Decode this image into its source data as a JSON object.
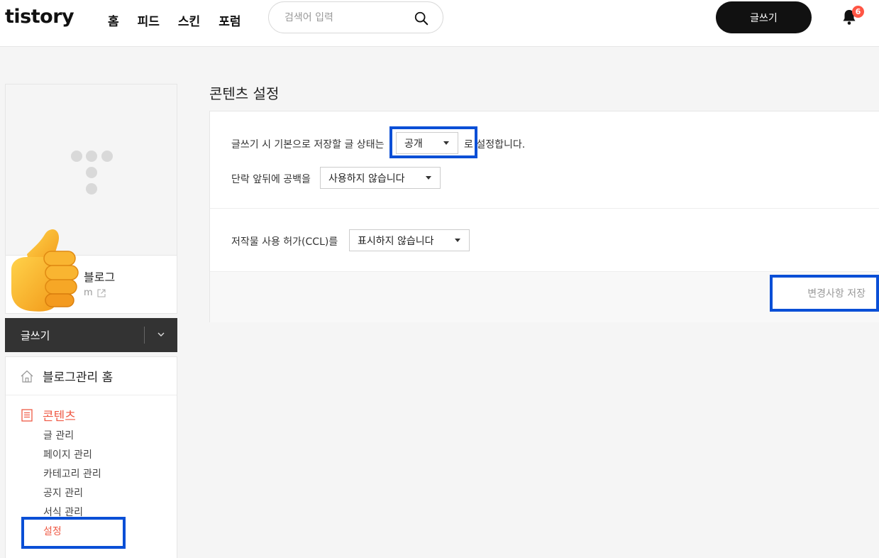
{
  "header": {
    "logo": "tistory",
    "nav": [
      "홈",
      "피드",
      "스킨",
      "포럼"
    ],
    "search_placeholder": "검색어 입력",
    "write_label": "글쓰기",
    "notification_count": "6"
  },
  "sidebar": {
    "blog_name": "블로그",
    "blog_url_fragment": "m",
    "write_label": "글쓰기",
    "home_label": "블로그관리 홈",
    "content_label": "콘텐츠",
    "submenu": [
      "글 관리",
      "페이지 관리",
      "카테고리 관리",
      "공지 관리",
      "서식 관리",
      "설정"
    ]
  },
  "main": {
    "title": "콘텐츠 설정",
    "row1_prefix": "글쓰기 시 기본으로 저장할 글 상태는",
    "row1_value": "공개",
    "row1_suffix": "로 설정합니다.",
    "row2_prefix": "단락 앞뒤에 공백을",
    "row2_value": "사용하지 않습니다",
    "row3_prefix": "저작물 사용 허가(CCL)를",
    "row3_value": "표시하지 않습니다",
    "save_label": "변경사항 저장"
  },
  "colors": {
    "accent": "#ef5a45",
    "highlight": "#0a4fd6",
    "badge": "#ff5544"
  }
}
